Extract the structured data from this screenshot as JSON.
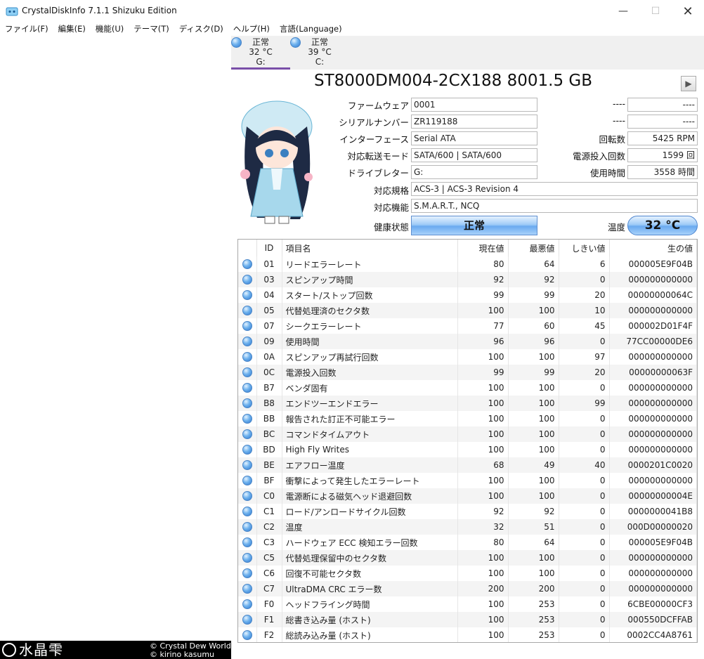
{
  "window": {
    "title": "CrystalDiskInfo 7.1.1 Shizuku Edition",
    "minimize_label": "—",
    "maximize_label": "☐",
    "close_label": "✕"
  },
  "menu": [
    "ファイル(F)",
    "編集(E)",
    "機能(U)",
    "テーマ(T)",
    "ディスク(D)",
    "ヘルプ(H)",
    "言語(Language)"
  ],
  "disk_tabs": [
    {
      "status": "正常",
      "temp": "32 °C",
      "drive": "G:",
      "active": true
    },
    {
      "status": "正常",
      "temp": "39 °C",
      "drive": "C:",
      "active": false
    }
  ],
  "disk": {
    "model": "ST8000DM004-2CX188 8001.5 GB",
    "next_label": "▶",
    "firmware_label": "ファームウェア",
    "firmware": "0001",
    "serial_label": "シリアルナンバー",
    "serial": "ZR119188",
    "interface_label": "インターフェース",
    "interface": "Serial ATA",
    "transfer_label": "対応転送モード",
    "transfer": "SATA/600 | SATA/600",
    "drive_letter_label": "ドライブレター",
    "drive_letter": "G:",
    "standard_label": "対応規格",
    "standard": "ACS-3 | ACS-3 Revision 4",
    "features_label": "対応機能",
    "features": "S.M.A.R.T., NCQ",
    "health_label": "健康状態",
    "health": "正常",
    "temp_label": "温度",
    "temp": "32 °C",
    "blank_label_1": "----",
    "blank_value_1": "----",
    "blank_label_2": "----",
    "blank_value_2": "----",
    "rotation_label": "回転数",
    "rotation": "5425 RPM",
    "power_count_label": "電源投入回数",
    "power_count": "1599 回",
    "power_hours_label": "使用時間",
    "power_hours": "3558 時間"
  },
  "smart": {
    "headers": {
      "id": "ID",
      "name": "項目名",
      "current": "現在値",
      "worst": "最悪値",
      "threshold": "しきい値",
      "raw": "生の値"
    },
    "rows": [
      [
        "01",
        "リードエラーレート",
        "80",
        "64",
        "6",
        "000005E9F04B"
      ],
      [
        "03",
        "スピンアップ時間",
        "92",
        "92",
        "0",
        "000000000000"
      ],
      [
        "04",
        "スタート/ストップ回数",
        "99",
        "99",
        "20",
        "00000000064C"
      ],
      [
        "05",
        "代替処理済のセクタ数",
        "100",
        "100",
        "10",
        "000000000000"
      ],
      [
        "07",
        "シークエラーレート",
        "77",
        "60",
        "45",
        "000002D01F4F"
      ],
      [
        "09",
        "使用時間",
        "96",
        "96",
        "0",
        "77CC00000DE6"
      ],
      [
        "0A",
        "スピンアップ再試行回数",
        "100",
        "100",
        "97",
        "000000000000"
      ],
      [
        "0C",
        "電源投入回数",
        "99",
        "99",
        "20",
        "00000000063F"
      ],
      [
        "B7",
        "ベンダ固有",
        "100",
        "100",
        "0",
        "000000000000"
      ],
      [
        "B8",
        "エンドツーエンドエラー",
        "100",
        "100",
        "99",
        "000000000000"
      ],
      [
        "BB",
        "報告された訂正不可能エラー",
        "100",
        "100",
        "0",
        "000000000000"
      ],
      [
        "BC",
        "コマンドタイムアウト",
        "100",
        "100",
        "0",
        "000000000000"
      ],
      [
        "BD",
        "High Fly Writes",
        "100",
        "100",
        "0",
        "000000000000"
      ],
      [
        "BE",
        "エアフロー温度",
        "68",
        "49",
        "40",
        "0000201C0020"
      ],
      [
        "BF",
        "衝撃によって発生したエラーレート",
        "100",
        "100",
        "0",
        "000000000000"
      ],
      [
        "C0",
        "電源断による磁気ヘッド退避回数",
        "100",
        "100",
        "0",
        "00000000004E"
      ],
      [
        "C1",
        "ロード/アンロードサイクル回数",
        "92",
        "92",
        "0",
        "0000000041B8"
      ],
      [
        "C2",
        "温度",
        "32",
        "51",
        "0",
        "000D00000020"
      ],
      [
        "C3",
        "ハードウェア ECC 検知エラー回数",
        "80",
        "64",
        "0",
        "000005E9F04B"
      ],
      [
        "C5",
        "代替処理保留中のセクタ数",
        "100",
        "100",
        "0",
        "000000000000"
      ],
      [
        "C6",
        "回復不可能セクタ数",
        "100",
        "100",
        "0",
        "000000000000"
      ],
      [
        "C7",
        "UltraDMA CRC エラー数",
        "200",
        "200",
        "0",
        "000000000000"
      ],
      [
        "F0",
        "ヘッドフライング時間",
        "100",
        "253",
        "0",
        "6CBE00000CF3"
      ],
      [
        "F1",
        "総書き込み量 (ホスト)",
        "100",
        "253",
        "0",
        "000550DCFFAB"
      ],
      [
        "F2",
        "総読み込み量 (ホスト)",
        "100",
        "253",
        "0",
        "0002CC4A8761"
      ]
    ]
  },
  "credits": {
    "logo": "水晶雫",
    "line1": "© Crystal Dew World",
    "line2": "© kirino kasumu"
  },
  "colors": {
    "accent_tab": "#7a4fa8",
    "status_good": "#6aaaf0"
  }
}
